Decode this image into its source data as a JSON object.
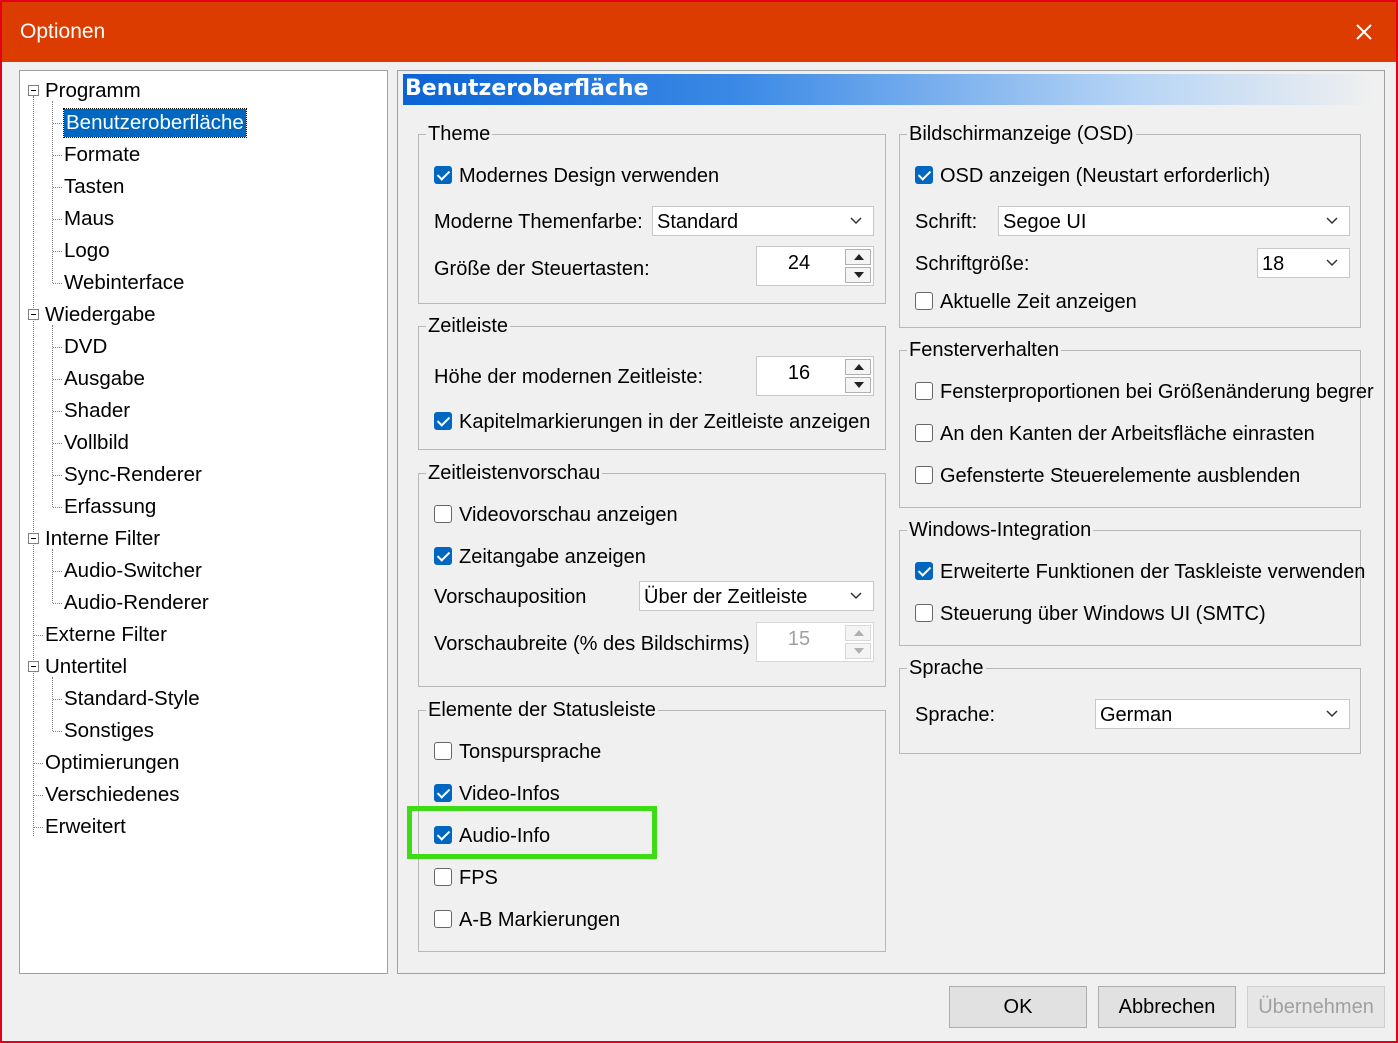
{
  "window": {
    "title": "Optionen"
  },
  "tree": {
    "items": [
      {
        "label": "Programm",
        "expanded": true
      },
      {
        "label": "Benutzeroberfläche",
        "selected": true
      },
      {
        "label": "Formate"
      },
      {
        "label": "Tasten"
      },
      {
        "label": "Maus"
      },
      {
        "label": "Logo"
      },
      {
        "label": "Webinterface"
      },
      {
        "label": "Wiedergabe",
        "expanded": true
      },
      {
        "label": "DVD"
      },
      {
        "label": "Ausgabe"
      },
      {
        "label": "Shader"
      },
      {
        "label": "Vollbild"
      },
      {
        "label": "Sync-Renderer"
      },
      {
        "label": "Erfassung"
      },
      {
        "label": "Interne Filter",
        "expanded": true
      },
      {
        "label": "Audio-Switcher"
      },
      {
        "label": "Audio-Renderer"
      },
      {
        "label": "Externe Filter"
      },
      {
        "label": "Untertitel",
        "expanded": true
      },
      {
        "label": "Standard-Style"
      },
      {
        "label": "Sonstiges"
      },
      {
        "label": "Optimierungen"
      },
      {
        "label": "Verschiedenes"
      },
      {
        "label": "Erweitert"
      }
    ]
  },
  "panel": {
    "header": "Benutzeroberfläche",
    "theme": {
      "legend": "Theme",
      "modern_design": {
        "label": "Modernes Design verwenden",
        "checked": true
      },
      "color_label": "Moderne Themenfarbe:",
      "color_value": "Standard",
      "button_size_label": "Größe der Steuertasten:",
      "button_size_value": "24"
    },
    "timeline": {
      "legend": "Zeitleiste",
      "height_label": "Höhe der modernen Zeitleiste:",
      "height_value": "16",
      "chapters": {
        "label": "Kapitelmarkierungen in der Zeitleiste anzeigen",
        "checked": true
      }
    },
    "preview": {
      "legend": "Zeitleistenvorschau",
      "video_preview": {
        "label": "Videovorschau anzeigen",
        "checked": false
      },
      "time_info": {
        "label": "Zeitangabe anzeigen",
        "checked": true
      },
      "position_label": "Vorschauposition",
      "position_value": "Über der Zeitleiste",
      "width_label": "Vorschaubreite (% des Bildschirms)",
      "width_value": "15"
    },
    "statusbar": {
      "legend": "Elemente der Statusleiste",
      "items": [
        {
          "label": "Tonspursprache",
          "checked": false
        },
        {
          "label": "Video-Infos",
          "checked": true
        },
        {
          "label": "Audio-Info",
          "checked": true
        },
        {
          "label": "FPS",
          "checked": false
        },
        {
          "label": "A-B Markierungen",
          "checked": false
        }
      ]
    },
    "osd": {
      "legend": "Bildschirmanzeige (OSD)",
      "show": {
        "label": "OSD anzeigen (Neustart erforderlich)",
        "checked": true
      },
      "font_label": "Schrift:",
      "font_value": "Segoe UI",
      "size_label": "Schriftgröße:",
      "size_value": "18",
      "clock": {
        "label": "Aktuelle Zeit anzeigen",
        "checked": false
      }
    },
    "window_behavior": {
      "legend": "Fensterverhalten",
      "items": [
        {
          "label": "Fensterproportionen bei Größenänderung begrer",
          "checked": false
        },
        {
          "label": "An den Kanten der Arbeitsfläche einrasten",
          "checked": false
        },
        {
          "label": "Gefensterte Steuerelemente ausblenden",
          "checked": false
        }
      ]
    },
    "windows_integration": {
      "legend": "Windows-Integration",
      "items": [
        {
          "label": "Erweiterte Funktionen der Taskleiste verwenden",
          "checked": true
        },
        {
          "label": "Steuerung über Windows UI (SMTC)",
          "checked": false
        }
      ]
    },
    "language": {
      "legend": "Sprache",
      "label": "Sprache:",
      "value": "German"
    }
  },
  "buttons": {
    "ok": "OK",
    "cancel": "Abbrechen",
    "apply": "Übernehmen"
  },
  "colors": {
    "titlebar": "#dc3c00",
    "accent": "#0067c0",
    "highlight": "#3ddc14"
  }
}
